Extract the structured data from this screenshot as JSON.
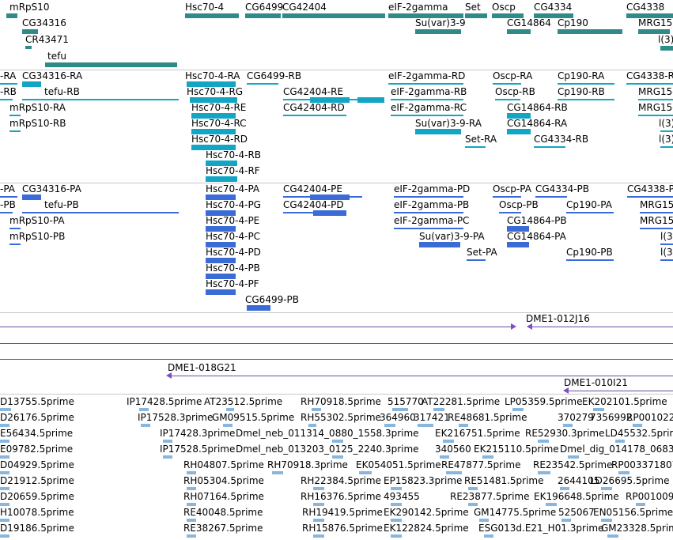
{
  "genes": {
    "labels": [
      "mRpS10",
      "CG34316",
      "CR43471",
      "tefu",
      "Hsc70-4",
      "CG6499",
      "CG42404",
      "eIF-2gamma",
      "Set",
      "Su(var)3-9",
      "Oscp",
      "CG4334",
      "CG14864",
      "Cp190",
      "CG4338",
      "MRG15",
      "l(3)"
    ]
  },
  "transcripts": {
    "labels": [
      "-RA",
      "CG34316-RA",
      "-RB",
      "tefu-RB",
      "mRpS10-RA",
      "mRpS10-RB",
      "Hsc70-4-RA",
      "CG6499-RB",
      "Hsc70-4-RG",
      "Hsc70-4-RE",
      "Hsc70-4-RC",
      "Hsc70-4-RD",
      "Hsc70-4-RB",
      "Hsc70-4-RF",
      "CG42404-RE",
      "CG42404-RD",
      "eIF-2gamma-RD",
      "eIF-2gamma-RB",
      "eIF-2gamma-RC",
      "Su(var)3-9-RA",
      "Set-RA",
      "Oscp-RA",
      "Oscp-RB",
      "CG14864-RB",
      "CG14864-RA",
      "Cp190-RA",
      "Cp190-RB",
      "CG4334-RB",
      "CG4338-R",
      "MRG15-",
      "MRG15-",
      "l(3)",
      "l(3)"
    ]
  },
  "peptides": {
    "labels": [
      "-PA",
      "CG34316-PA",
      "-PB",
      "tefu-PB",
      "mRpS10-PA",
      "mRpS10-PB",
      "Hsc70-4-PA",
      "Hsc70-4-PG",
      "Hsc70-4-PE",
      "Hsc70-4-PC",
      "Hsc70-4-PD",
      "Hsc70-4-PB",
      "Hsc70-4-PF",
      "CG6499-PB",
      "CG42404-PE",
      "CG42404-PD",
      "eIF-2gamma-PD",
      "eIF-2gamma-PB",
      "eIF-2gamma-PC",
      "Su(var)3-9-PA",
      "Set-PA",
      "Oscp-PA",
      "CG4334-PB",
      "Oscp-PB",
      "CG14864-PB",
      "CG14864-PA",
      "Cp190-PA",
      "Cp190-PB",
      "CG4338-P",
      "MRG15",
      "MRG15",
      "l(3)",
      "l(3)"
    ]
  },
  "clones": {
    "labels": [
      "DME1-012J16",
      "DME1-018G21",
      "DME1-010I21"
    ]
  },
  "ests": {
    "labels": [
      "D13755.5prime",
      "IP17428.5prime",
      "AT23512.5prime",
      "RH70918.5prime",
      "515770",
      "AT22281.5prime",
      "LP05359.5prime",
      "EK202101.5prime",
      "D26176.5prime",
      "IP17528.3prime",
      "GM09515.5prime",
      "RH55302.5prime",
      "364960",
      "317421",
      "RE48681.5prime",
      "370279",
      "7356992",
      "RP001022",
      "E56434.5prime",
      "IP17428.3prime",
      "Dmel_neb_011314_0880_1558.3prime",
      "EK216751.5prime",
      "RE52930.3prime",
      "LD45532.5prime",
      "E09782.5prime",
      "IP17528.5prime",
      "Dmel_neb_013203_0125_2240.3prime",
      "340560",
      "EK215110.5prime",
      "Dmel_dig_014178_0683",
      "D04929.5prime",
      "RH04807.5prime",
      "RH70918.3prime",
      "EK054051.5prime",
      "RE47877.5prime",
      "RE23542.5prime",
      "RP003371807",
      "D21912.5prime",
      "RH05304.5prime",
      "RH22384.5prime",
      "EP15823.3prime",
      "RE51481.5prime",
      "2644105",
      "LD26695.5prime",
      "D20659.5prime",
      "RH07164.5prime",
      "RH16376.5prime",
      "493455",
      "RE23877.5prime",
      "EK196648.5prime",
      "RP001009",
      "H10078.5prime",
      "RE40048.5prime",
      "RH19419.5prime",
      "EK290142.5prime",
      "GM14775.5prime",
      "525067",
      "EN05156.5prime",
      "D19186.5prime",
      "RE38267.5prime",
      "RH15876.5prime",
      "EK122824.5prime",
      "ESG013d.E21_H01.3prime",
      "GM23328.5prime"
    ]
  },
  "colors": {
    "gene": "#2f8b87",
    "transcript": "#12a6c4",
    "peptide": "#3a6bd6",
    "clone": "#6a4aa6",
    "est": "#88b6dd",
    "separator": "#c8c8c8"
  }
}
